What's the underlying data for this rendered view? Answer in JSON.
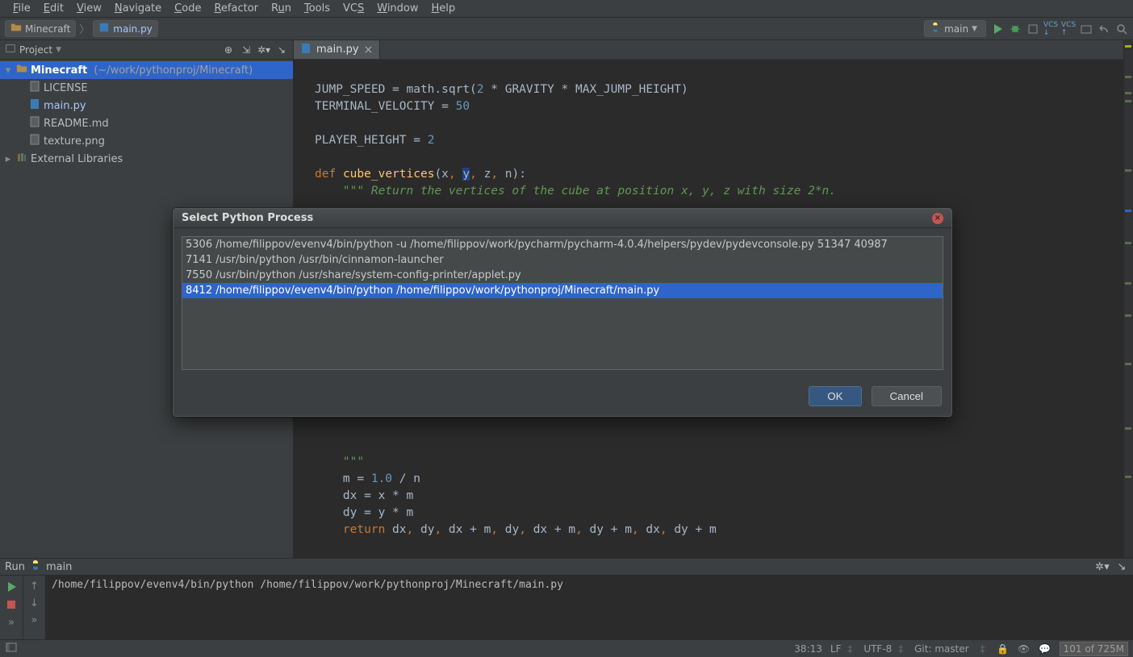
{
  "menu": {
    "file": "File",
    "edit": "Edit",
    "view": "View",
    "navigate": "Navigate",
    "code": "Code",
    "refactor": "Refactor",
    "run": "Run",
    "tools": "Tools",
    "vcs": "VCS",
    "window": "Window",
    "help": "Help"
  },
  "breadcrumb": {
    "project": "Minecraft",
    "file": "main.py"
  },
  "runconfig": {
    "label": "main"
  },
  "project_tool": {
    "title": "Project",
    "root_name": "Minecraft",
    "root_path": "(~/work/pythonproj/Minecraft)",
    "files": [
      "LICENSE",
      "main.py",
      "README.md",
      "texture.png"
    ],
    "external": "External Libraries"
  },
  "editor": {
    "tab_label": "main.py",
    "code_lines": [
      {
        "t": "JUMP_SPEED = math.sqrt(",
        "n": "2",
        "t2": " * GRAVITY * MAX_JUMP_HEIGHT)"
      },
      {
        "t": "TERMINAL_VELOCITY = ",
        "n": "50"
      },
      {
        "t": ""
      },
      {
        "t": "PLAYER_HEIGHT = ",
        "n": "2"
      },
      {
        "t": ""
      },
      {
        "kw": "def",
        "fn": "cube_vertices",
        "sig": "(x, y, z, n):",
        "y_idx": 1
      },
      {
        "doc": "    \"\"\" Return the vertices of the cube at position x, y, z with size 2*n."
      },
      {
        "t": ""
      },
      {
        "doc": "    \"\"\""
      },
      {
        "hidden_by_dialog": true
      },
      {
        "t": ""
      },
      {
        "doc": "    \"\"\""
      },
      {
        "t": "    m = ",
        "n": "1.0",
        "t2": " / n"
      },
      {
        "t": "    dx = x * m"
      },
      {
        "t": "    dy = y * m"
      },
      {
        "kw": "    return",
        "ret": " dx, dy, dx + m, dy, dx + m, dy + m, dx, dy + m"
      }
    ]
  },
  "dialog": {
    "title": "Select Python Process",
    "processes": [
      "5306 /home/filippov/evenv4/bin/python -u /home/filippov/work/pycharm/pycharm-4.0.4/helpers/pydev/pydevconsole.py 51347 40987",
      "7141 /usr/bin/python /usr/bin/cinnamon-launcher",
      "7550 /usr/bin/python /usr/share/system-config-printer/applet.py",
      "8412 /home/filippov/evenv4/bin/python /home/filippov/work/pythonproj/Minecraft/main.py"
    ],
    "selected_index": 3,
    "ok": "OK",
    "cancel": "Cancel"
  },
  "run_tool": {
    "tab": "Run",
    "config": "main",
    "console_line": "/home/filippov/evenv4/bin/python /home/filippov/work/pythonproj/Minecraft/main.py"
  },
  "status": {
    "caret": "38:13",
    "eol": "LF",
    "encoding": "UTF-8",
    "git": "Git: master",
    "mem": "101 of 725M"
  }
}
